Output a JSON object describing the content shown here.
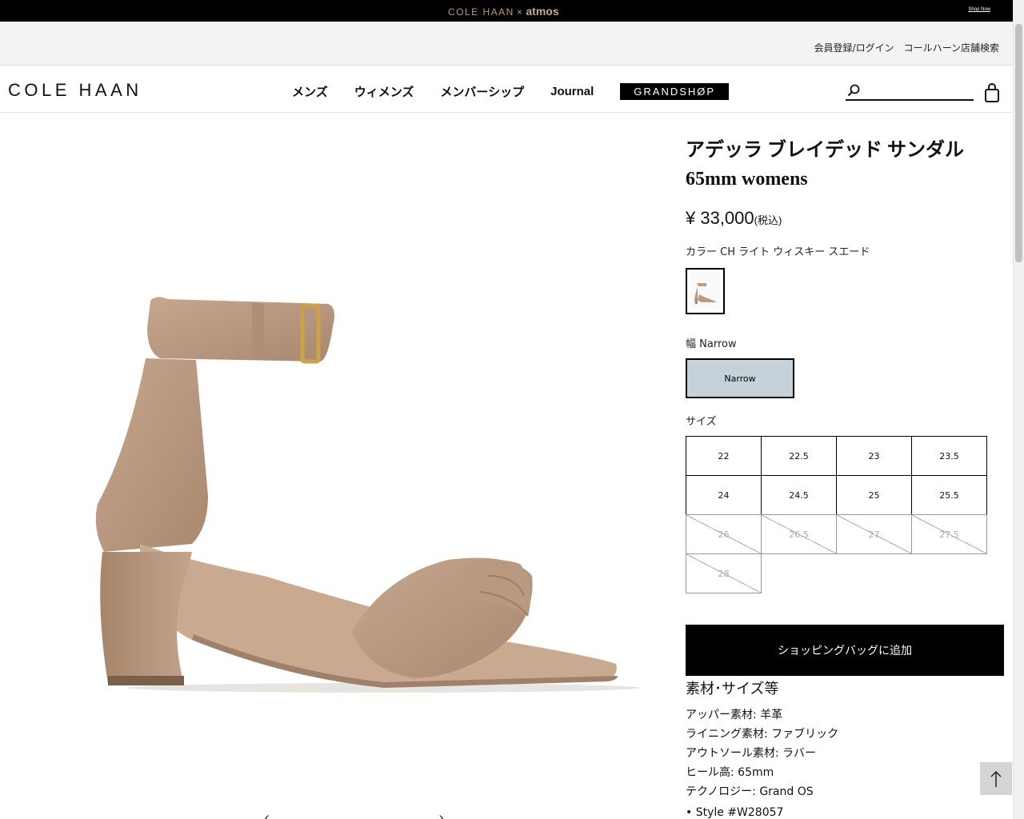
{
  "promo": {
    "brand": "COLE HAAN",
    "x": "×",
    "partner": "atmos",
    "link": "Shop Now"
  },
  "utility": {
    "login": "会員登録/ログイン",
    "store_search": "コールハーン店舗検索"
  },
  "header": {
    "logo": "COLE HAAN",
    "nav": [
      "メンズ",
      "ウィメンズ",
      "メンバーシップ",
      "Journal"
    ],
    "grandshop": "GRANDSHØP",
    "search_placeholder": ""
  },
  "product": {
    "title": "アデッラ ブレイデッド サンダル 65mm womens",
    "price": "¥ 33,000",
    "tax": "(税込)",
    "color_label": "カラー",
    "color_value": "CH ライト ウィスキー スエード",
    "width_label": "幅",
    "width_value": "Narrow",
    "width_option": "Narrow",
    "size_label": "サイズ",
    "sizes": [
      {
        "label": "22",
        "available": true
      },
      {
        "label": "22.5",
        "available": true
      },
      {
        "label": "23",
        "available": true
      },
      {
        "label": "23.5",
        "available": true
      },
      {
        "label": "24",
        "available": true
      },
      {
        "label": "24.5",
        "available": true
      },
      {
        "label": "25",
        "available": true
      },
      {
        "label": "25.5",
        "available": true
      },
      {
        "label": "26",
        "available": false
      },
      {
        "label": "26.5",
        "available": false
      },
      {
        "label": "27",
        "available": false
      },
      {
        "label": "27.5",
        "available": false
      },
      {
        "label": "28",
        "available": false
      }
    ],
    "add_to_bag": "ショッピングバッグに追加",
    "details_heading": "素材･サイズ等",
    "details": [
      "アッパー素材: 羊革",
      "ライニング素材: ファブリック",
      "アウトソール素材: ラバー",
      "ヒール高: 65mm",
      "テクノロジー: Grand OS"
    ],
    "style_line": "•  Style #W28057"
  },
  "colors": {
    "accent_gold": "#b89d7c",
    "width_selected_bg": "#c5d2da",
    "suede": "#bb9c83"
  },
  "icons": {
    "search": "search-icon",
    "cart": "shopping-bag-icon",
    "back_to_top": "arrow-up-icon",
    "prev": "chevron-left-icon",
    "next": "chevron-right-icon"
  }
}
